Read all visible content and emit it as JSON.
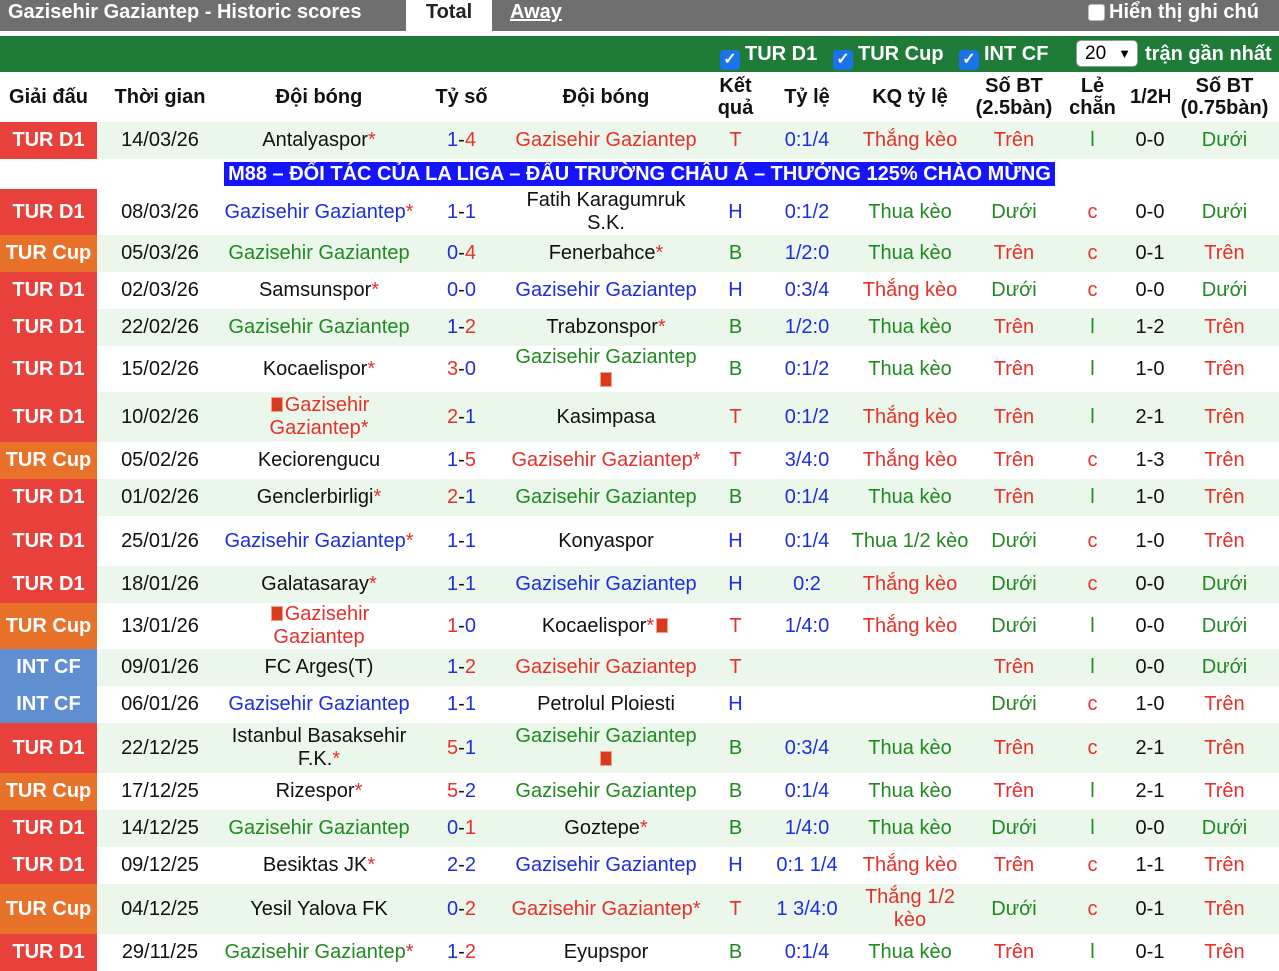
{
  "header": {
    "title": "Gazisehir Gaziantep - Historic scores",
    "tab_total": "Total",
    "tab_away": "Away",
    "toggle_note": "Hiển thị ghi chú"
  },
  "filters": {
    "f1": "TUR D1",
    "f2": "TUR Cup",
    "f3": "INT CF",
    "count": "20",
    "recent_label": "trận gần nhất"
  },
  "columns": [
    "Giải đấu",
    "Thời gian",
    "Đội bóng",
    "Tỷ số",
    "Đội bóng",
    "Kết quả",
    "Tỷ lệ",
    "KQ tỷ lệ",
    "Số BT (2.5bàn)",
    "Lẻ chẵn",
    "1/2H",
    "Số BT (0.75bàn)"
  ],
  "colors": {
    "TUR D1": "#e8413c",
    "TUR Cup": "#e8722a",
    "INT CF": "#5f8fd0",
    "red": "#e8302a",
    "blue": "#1a2fe0",
    "green": "#1f8a1f"
  },
  "ad_text": "M88 – ĐỐI TÁC CỦA LA LIGA – ĐẤU TRƯỜNG CHÂU Á – THƯỞNG 125% CHÀO MỪNG",
  "rows": [
    {
      "league": "TUR D1",
      "date": "14/03/26",
      "home": "Antalyaspor",
      "home_star": true,
      "home_c": "dk",
      "home_card": false,
      "s1": "1",
      "s2": "4",
      "s1c": "blue",
      "s2c": "red",
      "away": "Gazisehir Gaziantep",
      "away_star": false,
      "away_c": "red",
      "away_card": false,
      "result": "T",
      "res_c": "red",
      "odds": "0:1/4",
      "kq": "Thắng kèo",
      "kq_c": "red",
      "bt": "Trên",
      "bt_c": "red",
      "lc": "l",
      "lc_c": "green",
      "half": "0-0",
      "bt2": "Dưới",
      "bt2_c": "green",
      "shade": "g",
      "tall": false
    },
    {
      "league": "TUR D1",
      "date": "08/03/26",
      "home": "Gazisehir Gaziantep",
      "home_star": true,
      "home_c": "blue",
      "home_card": false,
      "s1": "1",
      "s2": "1",
      "s1c": "blue",
      "s2c": "blue",
      "away": "Fatih Karagumruk S.K.",
      "away_star": false,
      "away_c": "dk",
      "away_card": false,
      "result": "H",
      "res_c": "blue",
      "odds": "0:1/2",
      "kq": "Thua kèo",
      "kq_c": "green",
      "bt": "Dưới",
      "bt_c": "green",
      "lc": "c",
      "lc_c": "red",
      "half": "0-0",
      "bt2": "Dưới",
      "bt2_c": "green",
      "shade": "w",
      "tall": false
    },
    {
      "league": "TUR Cup",
      "date": "05/03/26",
      "home": "Gazisehir Gaziantep",
      "home_star": false,
      "home_c": "green",
      "home_card": false,
      "s1": "0",
      "s2": "4",
      "s1c": "blue",
      "s2c": "red",
      "away": "Fenerbahce",
      "away_star": true,
      "away_c": "dk",
      "away_card": false,
      "result": "B",
      "res_c": "green",
      "odds": "1/2:0",
      "kq": "Thua kèo",
      "kq_c": "green",
      "bt": "Trên",
      "bt_c": "red",
      "lc": "c",
      "lc_c": "red",
      "half": "0-1",
      "bt2": "Trên",
      "bt2_c": "red",
      "shade": "g",
      "tall": false
    },
    {
      "league": "TUR D1",
      "date": "02/03/26",
      "home": "Samsunspor",
      "home_star": true,
      "home_c": "dk",
      "home_card": false,
      "s1": "0",
      "s2": "0",
      "s1c": "blue",
      "s2c": "blue",
      "away": "Gazisehir Gaziantep",
      "away_star": false,
      "away_c": "blue",
      "away_card": false,
      "result": "H",
      "res_c": "blue",
      "odds": "0:3/4",
      "kq": "Thắng kèo",
      "kq_c": "red",
      "bt": "Dưới",
      "bt_c": "green",
      "lc": "c",
      "lc_c": "red",
      "half": "0-0",
      "bt2": "Dưới",
      "bt2_c": "green",
      "shade": "w",
      "tall": false
    },
    {
      "league": "TUR D1",
      "date": "22/02/26",
      "home": "Gazisehir Gaziantep",
      "home_star": false,
      "home_c": "green",
      "home_card": false,
      "s1": "1",
      "s2": "2",
      "s1c": "blue",
      "s2c": "red",
      "away": "Trabzonspor",
      "away_star": true,
      "away_c": "dk",
      "away_card": false,
      "result": "B",
      "res_c": "green",
      "odds": "1/2:0",
      "kq": "Thua kèo",
      "kq_c": "green",
      "bt": "Trên",
      "bt_c": "red",
      "lc": "l",
      "lc_c": "green",
      "half": "1-2",
      "bt2": "Trên",
      "bt2_c": "red",
      "shade": "g",
      "tall": false
    },
    {
      "league": "TUR D1",
      "date": "15/02/26",
      "home": "Kocaelispor",
      "home_star": true,
      "home_c": "dk",
      "home_card": false,
      "s1": "3",
      "s2": "0",
      "s1c": "red",
      "s2c": "blue",
      "away": "Gazisehir Gaziantep",
      "away_star": false,
      "away_c": "green",
      "away_card": true,
      "result": "B",
      "res_c": "green",
      "odds": "0:1/2",
      "kq": "Thua kèo",
      "kq_c": "green",
      "bt": "Trên",
      "bt_c": "red",
      "lc": "l",
      "lc_c": "green",
      "half": "1-0",
      "bt2": "Trên",
      "bt2_c": "red",
      "shade": "w",
      "tall": false
    },
    {
      "league": "TUR D1",
      "date": "10/02/26",
      "home": "Gazisehir Gaziantep",
      "home_star": true,
      "home_c": "red",
      "home_card": true,
      "s1": "2",
      "s2": "1",
      "s1c": "red",
      "s2c": "blue",
      "away": "Kasimpasa",
      "away_star": false,
      "away_c": "dk",
      "away_card": false,
      "result": "T",
      "res_c": "red",
      "odds": "0:1/2",
      "kq": "Thắng kèo",
      "kq_c": "red",
      "bt": "Trên",
      "bt_c": "red",
      "lc": "l",
      "lc_c": "green",
      "half": "2-1",
      "bt2": "Trên",
      "bt2_c": "red",
      "shade": "g",
      "tall": true
    },
    {
      "league": "TUR Cup",
      "date": "05/02/26",
      "home": "Keciorengucu",
      "home_star": false,
      "home_c": "dk",
      "home_card": false,
      "s1": "1",
      "s2": "5",
      "s1c": "blue",
      "s2c": "red",
      "away": "Gazisehir Gaziantep",
      "away_star": true,
      "away_c": "red",
      "away_card": false,
      "result": "T",
      "res_c": "red",
      "odds": "3/4:0",
      "kq": "Thắng kèo",
      "kq_c": "red",
      "bt": "Trên",
      "bt_c": "red",
      "lc": "c",
      "lc_c": "red",
      "half": "1-3",
      "bt2": "Trên",
      "bt2_c": "red",
      "shade": "w",
      "tall": false
    },
    {
      "league": "TUR D1",
      "date": "01/02/26",
      "home": "Genclerbirligi",
      "home_star": true,
      "home_c": "dk",
      "home_card": false,
      "s1": "2",
      "s2": "1",
      "s1c": "red",
      "s2c": "blue",
      "away": "Gazisehir Gaziantep",
      "away_star": false,
      "away_c": "green",
      "away_card": false,
      "result": "B",
      "res_c": "green",
      "odds": "0:1/4",
      "kq": "Thua kèo",
      "kq_c": "green",
      "bt": "Trên",
      "bt_c": "red",
      "lc": "l",
      "lc_c": "green",
      "half": "1-0",
      "bt2": "Trên",
      "bt2_c": "red",
      "shade": "g",
      "tall": false
    },
    {
      "league": "TUR D1",
      "date": "25/01/26",
      "home": "Gazisehir Gaziantep",
      "home_star": true,
      "home_c": "blue",
      "home_card": false,
      "s1": "1",
      "s2": "1",
      "s1c": "blue",
      "s2c": "blue",
      "away": "Konyaspor",
      "away_star": false,
      "away_c": "dk",
      "away_card": false,
      "result": "H",
      "res_c": "blue",
      "odds": "0:1/4",
      "kq": "Thua 1/2 kèo",
      "kq_c": "green",
      "bt": "Dưới",
      "bt_c": "green",
      "lc": "c",
      "lc_c": "red",
      "half": "1-0",
      "bt2": "Trên",
      "bt2_c": "red",
      "shade": "w",
      "tall": true
    },
    {
      "league": "TUR D1",
      "date": "18/01/26",
      "home": "Galatasaray",
      "home_star": true,
      "home_c": "dk",
      "home_card": false,
      "s1": "1",
      "s2": "1",
      "s1c": "blue",
      "s2c": "blue",
      "away": "Gazisehir Gaziantep",
      "away_star": false,
      "away_c": "blue",
      "away_card": false,
      "result": "H",
      "res_c": "blue",
      "odds": "0:2",
      "kq": "Thắng kèo",
      "kq_c": "red",
      "bt": "Dưới",
      "bt_c": "green",
      "lc": "c",
      "lc_c": "red",
      "half": "0-0",
      "bt2": "Dưới",
      "bt2_c": "green",
      "shade": "g",
      "tall": false
    },
    {
      "league": "TUR Cup",
      "date": "13/01/26",
      "home": "Gazisehir Gaziantep",
      "home_star": false,
      "home_c": "red",
      "home_card": true,
      "s1": "1",
      "s2": "0",
      "s1c": "red",
      "s2c": "blue",
      "away": "Kocaelispor",
      "away_star": true,
      "away_c": "dk",
      "away_card": true,
      "result": "T",
      "res_c": "red",
      "odds": "1/4:0",
      "kq": "Thắng kèo",
      "kq_c": "red",
      "bt": "Dưới",
      "bt_c": "green",
      "lc": "l",
      "lc_c": "green",
      "half": "0-0",
      "bt2": "Dưới",
      "bt2_c": "green",
      "shade": "w",
      "tall": false
    },
    {
      "league": "INT CF",
      "date": "09/01/26",
      "home": "FC Arges(T)",
      "home_star": false,
      "home_c": "dk",
      "home_card": false,
      "s1": "1",
      "s2": "2",
      "s1c": "blue",
      "s2c": "red",
      "away": "Gazisehir Gaziantep",
      "away_star": false,
      "away_c": "red",
      "away_card": false,
      "result": "T",
      "res_c": "red",
      "odds": "",
      "kq": "",
      "kq_c": "red",
      "bt": "Trên",
      "bt_c": "red",
      "lc": "l",
      "lc_c": "green",
      "half": "0-0",
      "bt2": "Dưới",
      "bt2_c": "green",
      "shade": "g",
      "tall": false
    },
    {
      "league": "INT CF",
      "date": "06/01/26",
      "home": "Gazisehir Gaziantep",
      "home_star": false,
      "home_c": "blue",
      "home_card": false,
      "s1": "1",
      "s2": "1",
      "s1c": "blue",
      "s2c": "blue",
      "away": "Petrolul Ploiesti",
      "away_star": false,
      "away_c": "dk",
      "away_card": false,
      "result": "H",
      "res_c": "blue",
      "odds": "",
      "kq": "",
      "kq_c": "red",
      "bt": "Dưới",
      "bt_c": "green",
      "lc": "c",
      "lc_c": "red",
      "half": "1-0",
      "bt2": "Trên",
      "bt2_c": "red",
      "shade": "w",
      "tall": false
    },
    {
      "league": "TUR D1",
      "date": "22/12/25",
      "home": "Istanbul Basaksehir F.K.",
      "home_star": true,
      "home_c": "dk",
      "home_card": false,
      "s1": "5",
      "s2": "1",
      "s1c": "red",
      "s2c": "blue",
      "away": "Gazisehir Gaziantep",
      "away_star": false,
      "away_c": "green",
      "away_card": true,
      "result": "B",
      "res_c": "green",
      "odds": "0:3/4",
      "kq": "Thua kèo",
      "kq_c": "green",
      "bt": "Trên",
      "bt_c": "red",
      "lc": "c",
      "lc_c": "red",
      "half": "2-1",
      "bt2": "Trên",
      "bt2_c": "red",
      "shade": "g",
      "tall": true
    },
    {
      "league": "TUR Cup",
      "date": "17/12/25",
      "home": "Rizespor",
      "home_star": true,
      "home_c": "dk",
      "home_card": false,
      "s1": "5",
      "s2": "2",
      "s1c": "red",
      "s2c": "blue",
      "away": "Gazisehir Gaziantep",
      "away_star": false,
      "away_c": "green",
      "away_card": false,
      "result": "B",
      "res_c": "green",
      "odds": "0:1/4",
      "kq": "Thua kèo",
      "kq_c": "green",
      "bt": "Trên",
      "bt_c": "red",
      "lc": "l",
      "lc_c": "green",
      "half": "2-1",
      "bt2": "Trên",
      "bt2_c": "red",
      "shade": "w",
      "tall": false
    },
    {
      "league": "TUR D1",
      "date": "14/12/25",
      "home": "Gazisehir Gaziantep",
      "home_star": false,
      "home_c": "green",
      "home_card": false,
      "s1": "0",
      "s2": "1",
      "s1c": "blue",
      "s2c": "red",
      "away": "Goztepe",
      "away_star": true,
      "away_c": "dk",
      "away_card": false,
      "result": "B",
      "res_c": "green",
      "odds": "1/4:0",
      "kq": "Thua kèo",
      "kq_c": "green",
      "bt": "Dưới",
      "bt_c": "green",
      "lc": "l",
      "lc_c": "green",
      "half": "0-0",
      "bt2": "Dưới",
      "bt2_c": "green",
      "shade": "g",
      "tall": false
    },
    {
      "league": "TUR D1",
      "date": "09/12/25",
      "home": "Besiktas JK",
      "home_star": true,
      "home_c": "dk",
      "home_card": false,
      "s1": "2",
      "s2": "2",
      "s1c": "blue",
      "s2c": "blue",
      "away": "Gazisehir Gaziantep",
      "away_star": false,
      "away_c": "blue",
      "away_card": false,
      "result": "H",
      "res_c": "blue",
      "odds": "0:1 1/4",
      "kq": "Thắng kèo",
      "kq_c": "red",
      "bt": "Trên",
      "bt_c": "red",
      "lc": "c",
      "lc_c": "red",
      "half": "1-1",
      "bt2": "Trên",
      "bt2_c": "red",
      "shade": "w",
      "tall": false
    },
    {
      "league": "TUR Cup",
      "date": "04/12/25",
      "home": "Yesil Yalova FK",
      "home_star": false,
      "home_c": "dk",
      "home_card": false,
      "s1": "0",
      "s2": "2",
      "s1c": "blue",
      "s2c": "red",
      "away": "Gazisehir Gaziantep",
      "away_star": true,
      "away_c": "red",
      "away_card": false,
      "result": "T",
      "res_c": "red",
      "odds": "1 3/4:0",
      "kq": "Thắng 1/2 kèo",
      "kq_c": "red",
      "bt": "Dưới",
      "bt_c": "green",
      "lc": "c",
      "lc_c": "red",
      "half": "0-1",
      "bt2": "Trên",
      "bt2_c": "red",
      "shade": "g",
      "tall": true
    },
    {
      "league": "TUR D1",
      "date": "29/11/25",
      "home": "Gazisehir Gaziantep",
      "home_star": true,
      "home_c": "green",
      "home_card": false,
      "s1": "1",
      "s2": "2",
      "s1c": "blue",
      "s2c": "red",
      "away": "Eyupspor",
      "away_star": false,
      "away_c": "dk",
      "away_card": false,
      "result": "B",
      "res_c": "green",
      "odds": "0:1/4",
      "kq": "Thua kèo",
      "kq_c": "green",
      "bt": "Trên",
      "bt_c": "red",
      "lc": "l",
      "lc_c": "green",
      "half": "0-1",
      "bt2": "Trên",
      "bt2_c": "red",
      "shade": "w",
      "tall": false
    }
  ]
}
